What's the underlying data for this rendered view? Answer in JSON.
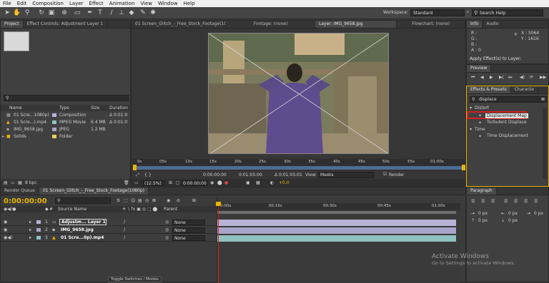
{
  "menu": [
    "File",
    "Edit",
    "Composition",
    "Layer",
    "Effect",
    "Animation",
    "View",
    "Window",
    "Help"
  ],
  "toolbar": {
    "workspace_label": "Workspace:",
    "workspace_value": "Standard",
    "search_placeholder": "Search Help"
  },
  "project": {
    "tab_project": "Project",
    "tab_effect_controls": "Effect Controls: Adjustment Layer 1",
    "columns": [
      "Name",
      "Type",
      "Size",
      "Duration"
    ],
    "items": [
      {
        "name": "01 Scre...1080p)",
        "type": "Composition",
        "size": "",
        "duration": "Δ 0:01:0"
      },
      {
        "name": "01 Scre...).mp4",
        "type": "MPEG Movie",
        "size": "6.4 MB",
        "duration": "Δ 0:01:0"
      },
      {
        "name": "IMG_9658.jpg",
        "type": "JPEG",
        "size": "1.2 MB",
        "duration": ""
      },
      {
        "name": "Solids",
        "type": "Folder",
        "size": "",
        "duration": ""
      }
    ],
    "bpc": "8 bpc"
  },
  "viewer": {
    "tab_comp": "01 Screen_Glitch_-_Free_Stock_Footage(1080p)",
    "tab_footage": "Footage: (none)",
    "tab_layer": "Layer: IMG_9658.jpg",
    "tab_flowchart": "Flowchart: (none)",
    "ruler": [
      "0s",
      "05s",
      "10s",
      "15s",
      "20s",
      "25s",
      "30s",
      "35s",
      "40s",
      "45s",
      "50s",
      "55s",
      "01:00s"
    ],
    "timecodes": [
      "0:00:00:00",
      "0:01:05:00",
      "Δ 0:01:05:01"
    ],
    "view_label": "View:",
    "view_value": "Masks",
    "render_label": "Render",
    "zoom": "(12.5%)",
    "timecode_small": "0:00:00:00",
    "offset": "+0.0"
  },
  "info": {
    "tab_info": "Info",
    "tab_audio": "Audio",
    "r": "R :",
    "g": "G :",
    "b": "B :",
    "a": "A : 0",
    "x": "X : 5064",
    "y": "Y : 1616",
    "message": "Apply Effect(s) to Layer:"
  },
  "preview": {
    "title": "Preview"
  },
  "effects": {
    "tab_effects": "Effects & Presets",
    "tab_character": "Characte",
    "search_value": "displace",
    "groups": [
      {
        "name": "Distort",
        "items": [
          "Displacement Map",
          "Turbulent Displace"
        ]
      },
      {
        "name": "Time",
        "items": [
          "Time Displacement"
        ]
      }
    ],
    "highlight_color": "#d42020"
  },
  "timeline": {
    "tab_render": "Render Queue",
    "tab_comp": "01 Screen_Glitch_-_Free_Stock_Footage(1080p)",
    "timecode": "0:00:00:00",
    "col_source": "Source Name",
    "col_parent": "Parent",
    "ticks": [
      "0:00s",
      "00:15s",
      "00:30s",
      "00:45s",
      "01:00s"
    ],
    "layers": [
      {
        "num": "1",
        "name": "Adjustm... Layer 1",
        "parent": "None"
      },
      {
        "num": "2",
        "name": "IMG_9658.jpg",
        "parent": "None"
      },
      {
        "num": "3",
        "name": "01 Scre...0p).mp4",
        "parent": "None"
      }
    ],
    "toggle": "Toggle Switches / Modes"
  },
  "paragraph": {
    "title": "Paragraph",
    "values": [
      "0 px",
      "0 px",
      "0 px",
      "0 px",
      "0 px"
    ]
  },
  "watermark": {
    "title": "Activate Windows",
    "subtitle": "Go to Settings to activate Windows."
  },
  "colors": {
    "accent": "#e8b400",
    "layer_adj": "#b8b2d6",
    "layer_img": "#a9a4c9",
    "layer_mov": "#8fc2bf"
  }
}
